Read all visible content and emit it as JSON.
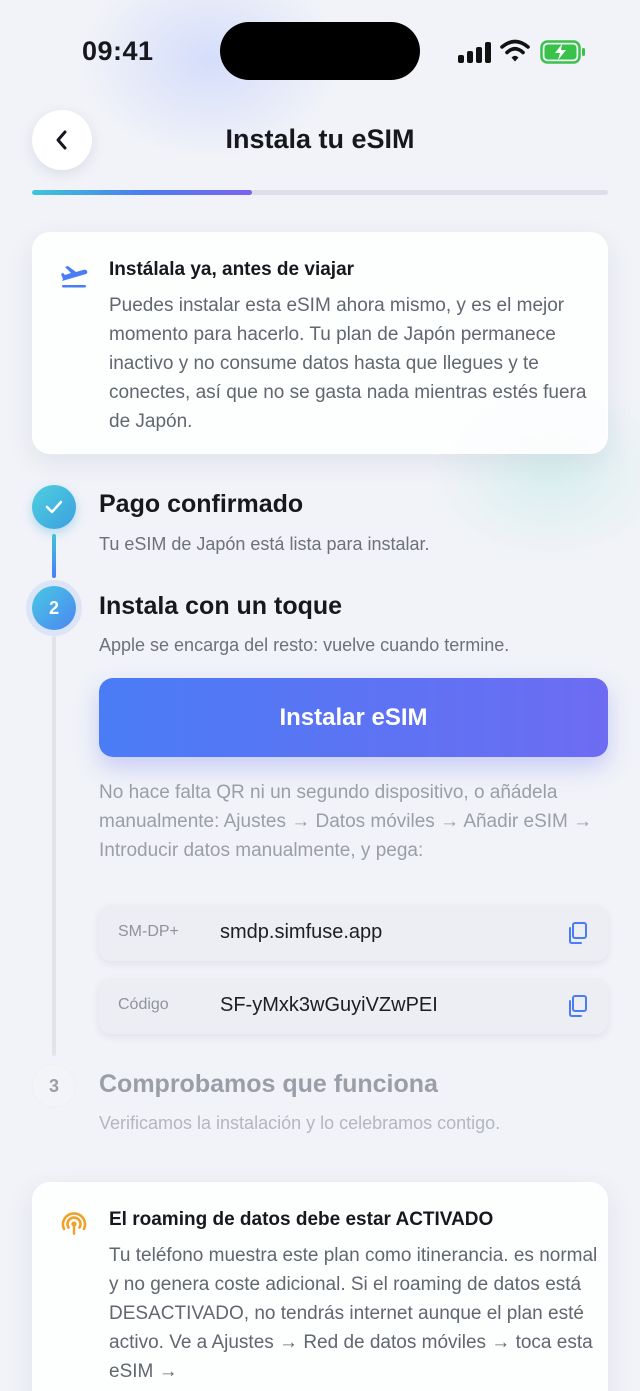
{
  "status_bar": {
    "time": "09:41"
  },
  "header": {
    "title": "Instala tu eSIM",
    "progress_fraction": 0.38
  },
  "info_card": {
    "icon": "airplane-departure-icon",
    "title": "Instálala ya, antes de viajar",
    "body": "Puedes instalar esta eSIM ahora mismo, y es el mejor momento para hacerlo. Tu plan de Japón permanece inactivo y no consume datos hasta que llegues y te conectes, así que no se gasta nada mientras estés fuera de Japón."
  },
  "steps": [
    {
      "number": "✓",
      "title": "Pago confirmado",
      "subtitle": "Tu eSIM de Japón está lista para instalar.",
      "state": "done"
    },
    {
      "number": "2",
      "title": "Instala con un toque",
      "subtitle": "Apple se encarga del resto: vuelve cuando termine.",
      "state": "active"
    },
    {
      "number": "3",
      "title": "Comprobamos que funciona",
      "subtitle": "Verificamos la instalación y lo celebramos contigo.",
      "state": "pending"
    }
  ],
  "install_button": {
    "label": "Instalar eSIM"
  },
  "manual": {
    "text": "No hace falta QR ni un segundo dispositivo, o añádela manualmente: Ajustes → Datos móviles → Añadir eSIM → Introducir datos manualmente, y pega:",
    "fields": [
      {
        "label": "SM-DP+",
        "value": "smdp.simfuse.app"
      },
      {
        "label": "Código",
        "value": "SF-yMxk3wGuyiVZwPEI"
      }
    ]
  },
  "roaming_card": {
    "icon": "roaming-signal-icon",
    "title": "El roaming de datos debe estar ACTIVADO",
    "body": "Tu teléfono muestra este plan como itinerancia. es normal y no genera coste adicional. Si el roaming de datos está DESACTIVADO, no tendrás internet aunque el plan esté activo. Ve a Ajustes → Red de datos móviles → toca esta eSIM →"
  },
  "colors": {
    "accent_blue": "#4a7cf6",
    "accent_teal": "#3fc6d8",
    "warning_orange": "#f0a12a"
  }
}
